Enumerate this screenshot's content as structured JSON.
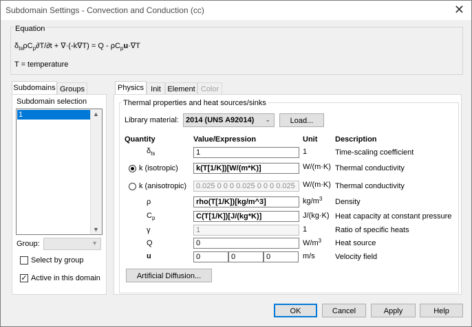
{
  "window": {
    "title": "Subdomain Settings - Convection and Conduction (cc)"
  },
  "equation": {
    "group_label": "Equation",
    "line1": "δtsρCp∂T/∂t + ∇·(-k∇T) = Q - ρCpu·∇T",
    "line2": "T = temperature"
  },
  "left_tabs": {
    "tab1": "Subdomains",
    "tab2": "Groups"
  },
  "subdomain_selection": {
    "label": "Subdomain selection",
    "items": [
      "1"
    ],
    "selected": "1"
  },
  "group": {
    "label": "Group:",
    "value": ""
  },
  "select_by_group": {
    "label": "Select by group",
    "checked": false
  },
  "active_in_domain": {
    "label": "Active in this domain",
    "checked": true
  },
  "right_tabs": {
    "physics": "Physics",
    "init": "Init",
    "element": "Element",
    "color": "Color"
  },
  "thermal": {
    "group_label": "Thermal properties and heat sources/sinks",
    "library_label": "Library material:",
    "library_value": "2014 (UNS A92014)",
    "load_button": "Load..."
  },
  "table": {
    "headers": {
      "quantity": "Quantity",
      "value": "Value/Expression",
      "unit": "Unit",
      "description": "Description"
    },
    "rows": [
      {
        "quantity": "δts",
        "value": "1",
        "unit": "1",
        "description": "Time-scaling coefficient"
      },
      {
        "quantity": "k (isotropic)",
        "value": "k(T[1/K])[W/(m*K)]",
        "unit": "W/(m·K)",
        "description": "Thermal conductivity"
      },
      {
        "quantity": "k (anisotropic)",
        "value": "0.025 0 0 0 0.025 0 0 0 0.025",
        "unit": "W/(m·K)",
        "description": "Thermal conductivity"
      },
      {
        "quantity": "ρ",
        "value": "rho(T[1/K])[kg/m^3]",
        "unit": "kg/m3",
        "description": "Density"
      },
      {
        "quantity": "Cp",
        "value": "C(T[1/K])[J/(kg*K)]",
        "unit": "J/(kg·K)",
        "description": "Heat capacity at constant pressure"
      },
      {
        "quantity": "γ",
        "value": "1",
        "unit": "1",
        "description": "Ratio of specific heats"
      },
      {
        "quantity": "Q",
        "value": "0",
        "unit": "W/m3",
        "description": "Heat source"
      },
      {
        "quantity": "u",
        "value": [
          "0",
          "0",
          "0"
        ],
        "unit": "m/s",
        "description": "Velocity field"
      }
    ]
  },
  "artificial_diffusion_button": "Artificial Diffusion...",
  "buttons": {
    "ok": "OK",
    "cancel": "Cancel",
    "apply": "Apply",
    "help": "Help"
  },
  "colors": {
    "selection": "#0078d7",
    "dialog_bg": "#f0f0f0"
  }
}
